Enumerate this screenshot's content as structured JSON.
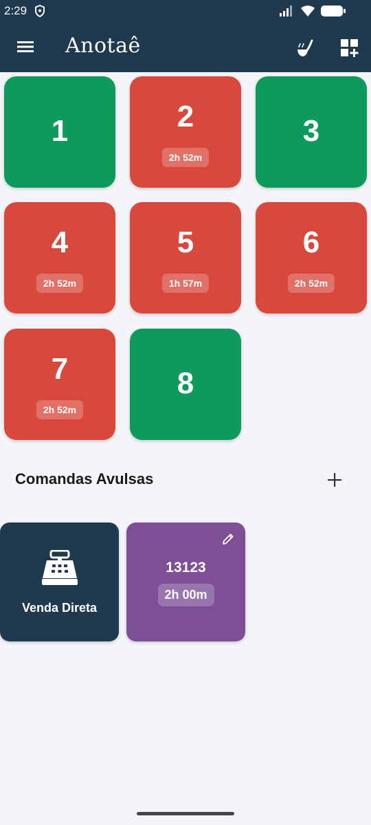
{
  "status": {
    "time": "2:29"
  },
  "appbar": {
    "title": "Anotaê",
    "menu_icon": "menu-icon",
    "actions": [
      "ladle-icon",
      "grid-add-icon"
    ]
  },
  "colors": {
    "appbar": "#1f3a4f",
    "free": "#0d9a5c",
    "busy": "#d9483d",
    "comanda_purple": "#7c4f96"
  },
  "tables": [
    {
      "number": "1",
      "state": "free",
      "timer": ""
    },
    {
      "number": "2",
      "state": "busy",
      "timer": "2h 52m"
    },
    {
      "number": "3",
      "state": "free",
      "timer": ""
    },
    {
      "number": "4",
      "state": "busy",
      "timer": "2h 52m"
    },
    {
      "number": "5",
      "state": "busy",
      "timer": "1h 57m"
    },
    {
      "number": "6",
      "state": "busy",
      "timer": "2h 52m"
    },
    {
      "number": "7",
      "state": "busy",
      "timer": "2h 52m"
    },
    {
      "number": "8",
      "state": "free",
      "timer": ""
    }
  ],
  "section": {
    "title": "Comandas Avulsas",
    "add_icon": "plus-icon"
  },
  "comandas": {
    "venda_direta": {
      "label": "Venda Direta",
      "icon": "cash-register-icon"
    },
    "open": [
      {
        "number": "13123",
        "timer": "2h 00m",
        "icon": "edit-icon"
      }
    ]
  }
}
